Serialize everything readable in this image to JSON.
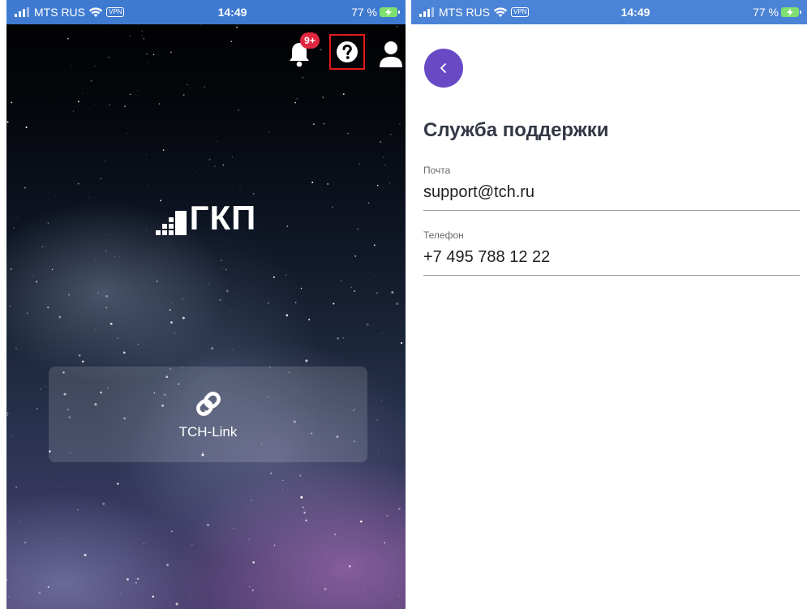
{
  "status_bar": {
    "carrier": "MTS RUS",
    "vpn": "VPN",
    "time": "14:49",
    "battery": "77 %",
    "color_left": "#3f7ad1",
    "color_right": "#4b83d6"
  },
  "left_screen": {
    "notification_badge": "9+",
    "logo_text": "ГКП",
    "card_label": "TCH-Link",
    "colors": {
      "badge": "#e0273f",
      "highlight_border": "#e31a1a"
    }
  },
  "right_screen": {
    "title": "Служба поддержки",
    "fields": [
      {
        "label": "Почта",
        "value": "support@tch.ru"
      },
      {
        "label": "Телефон",
        "value": "+7 495 788 12 22"
      }
    ],
    "colors": {
      "back_button": "#6a49c5",
      "title": "#333845"
    }
  },
  "icons": [
    "signal-icon",
    "wifi-icon",
    "battery-icon",
    "bell-icon",
    "help-icon",
    "profile-icon",
    "logo-bars-icon",
    "link-icon",
    "chevron-left-icon"
  ]
}
